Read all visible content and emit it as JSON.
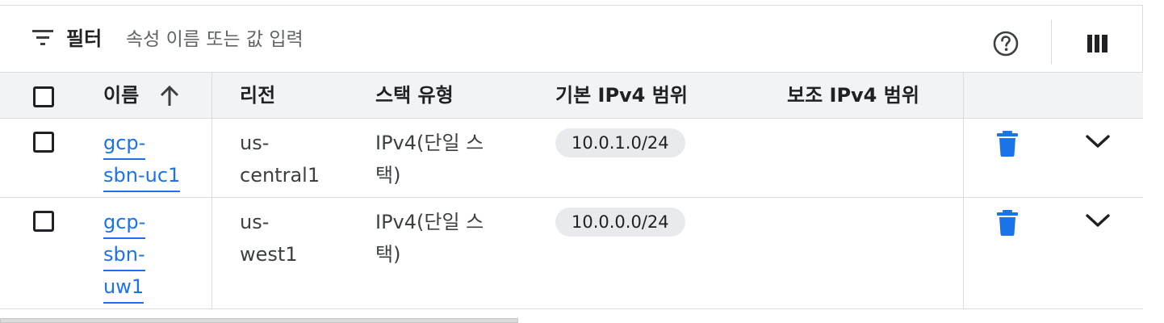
{
  "filter": {
    "label": "필터",
    "placeholder": "속성 이름 또는 값 입력"
  },
  "toolbar": {
    "help_icon": "help-circle-icon",
    "columns_icon": "column-display-icon"
  },
  "table": {
    "columns": [
      "이름",
      "리전",
      "스택 유형",
      "기본 IPv4 범위",
      "보조 IPv4 범위"
    ],
    "sort": {
      "column": "이름",
      "direction": "ascending",
      "icon": "arrow-up-icon"
    },
    "rows": [
      {
        "name_lines": [
          "gcp-",
          "sbn-uc1"
        ],
        "region_lines": [
          "us-",
          "central1"
        ],
        "stack_lines": [
          "IPv4(단일 스",
          "택)"
        ],
        "primary_range": "10.0.1.0/24",
        "secondary_range": "",
        "delete_icon": "trash-icon",
        "expand_icon": "chevron-down-icon"
      },
      {
        "name_lines": [
          "gcp-",
          "sbn-",
          "uw1"
        ],
        "region_lines": [
          "us-",
          "west1"
        ],
        "stack_lines": [
          "IPv4(단일 스",
          "택)"
        ],
        "primary_range": "10.0.0.0/24",
        "secondary_range": "",
        "delete_icon": "trash-icon",
        "expand_icon": "chevron-down-icon"
      }
    ]
  },
  "colors": {
    "link": "#1a73e8",
    "delete": "#1a73e8",
    "header_bg": "#f1f3f4",
    "chip_bg": "#e8eaed",
    "border": "#dadce0"
  }
}
